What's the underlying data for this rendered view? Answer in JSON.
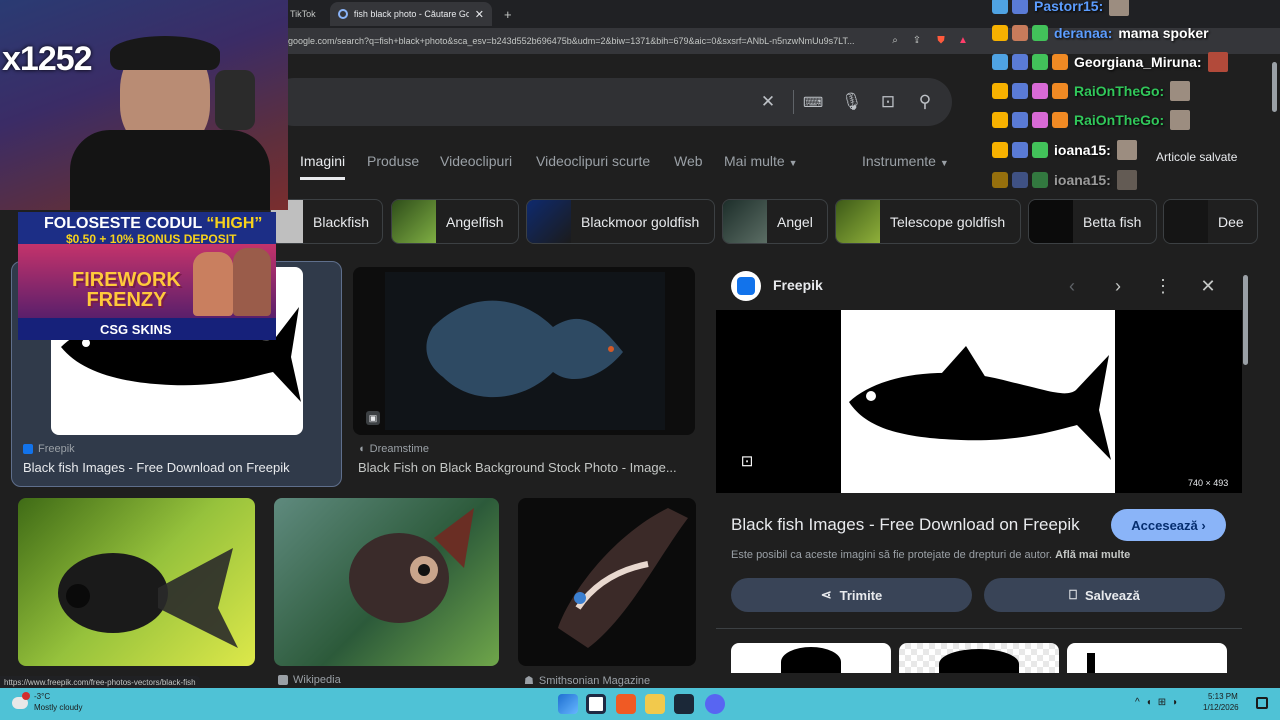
{
  "browser": {
    "tabs": [
      {
        "label": "TikTok",
        "active": false
      },
      {
        "label": "fish black photo - Căutare Goog",
        "active": true
      }
    ],
    "url": "google.com/search?q=fish+black+photo&sca_esv=b243d552b696475b&udm=2&biw=1371&bih=679&aic=0&sxsrf=ANbL-n5nzwNmUu9s7LT..."
  },
  "search": {
    "tabs": [
      "Imagini",
      "Produse",
      "Videoclipuri",
      "Videoclipuri scurte",
      "Web",
      "Mai multe",
      "Instrumente"
    ],
    "active_tab": "Imagini",
    "chips": [
      "Blackfish",
      "Angelfish",
      "Blackmoor goldfish",
      "Angel",
      "Telescope goldfish",
      "Betta fish",
      "Dee"
    ],
    "saved_label": "Articole salvate"
  },
  "results": [
    {
      "source": "Freepik",
      "title": "Black fish Images - Free Download on Freepik"
    },
    {
      "source": "Dreamstime",
      "title": "Black Fish on Black Background Stock Photo - Image..."
    },
    {
      "source": "",
      "title": ""
    },
    {
      "source": "Wikipedia",
      "title": ""
    },
    {
      "source": "Smithsonian Magazine",
      "title": ""
    }
  ],
  "panel": {
    "source": "Freepik",
    "title": "Black fish Images - Free Download on Freepik",
    "dimensions": "740 × 493",
    "visit_label": "Accesează",
    "copyright": "Este posibil ca aceste imagini să fie protejate de drepturi de autor.",
    "learn_more": "Află mai multe",
    "share_label": "Trimite",
    "save_label": "Salvează"
  },
  "status_url": "https://www.freepik.com/free-photos-vectors/black-fish",
  "taskbar": {
    "weather_temp": "-3°C",
    "weather_desc": "Mostly cloudy",
    "time": "5:13 PM",
    "date": "1/12/2026"
  },
  "overlay": {
    "counter": "x1252",
    "promo_line1_a": "FOLOSESTE CODUL ",
    "promo_line1_b": "“HIGH”",
    "promo_line2": "$0.50 + 10% BONUS DEPOSIT",
    "promo_game": "FIREWORK\nFRENZY",
    "promo_brand": "CSG SKINS",
    "chat": [
      {
        "name": "Pastorr15:",
        "color": "#5c9dff",
        "msg": ""
      },
      {
        "name": "deranaa:",
        "color": "#5c9dff",
        "msg": "mama spoker"
      },
      {
        "name": "Georgiana_Miruna:",
        "color": "#ffffff",
        "msg": ""
      },
      {
        "name": "RaiOnTheGo:",
        "color": "#31c75a",
        "msg": ""
      },
      {
        "name": "RaiOnTheGo:",
        "color": "#31c75a",
        "msg": ""
      },
      {
        "name": "ioana15:",
        "color": "#ffffff",
        "msg": ""
      },
      {
        "name": "ioana15:",
        "color": "#ffffff",
        "msg": ""
      }
    ]
  }
}
